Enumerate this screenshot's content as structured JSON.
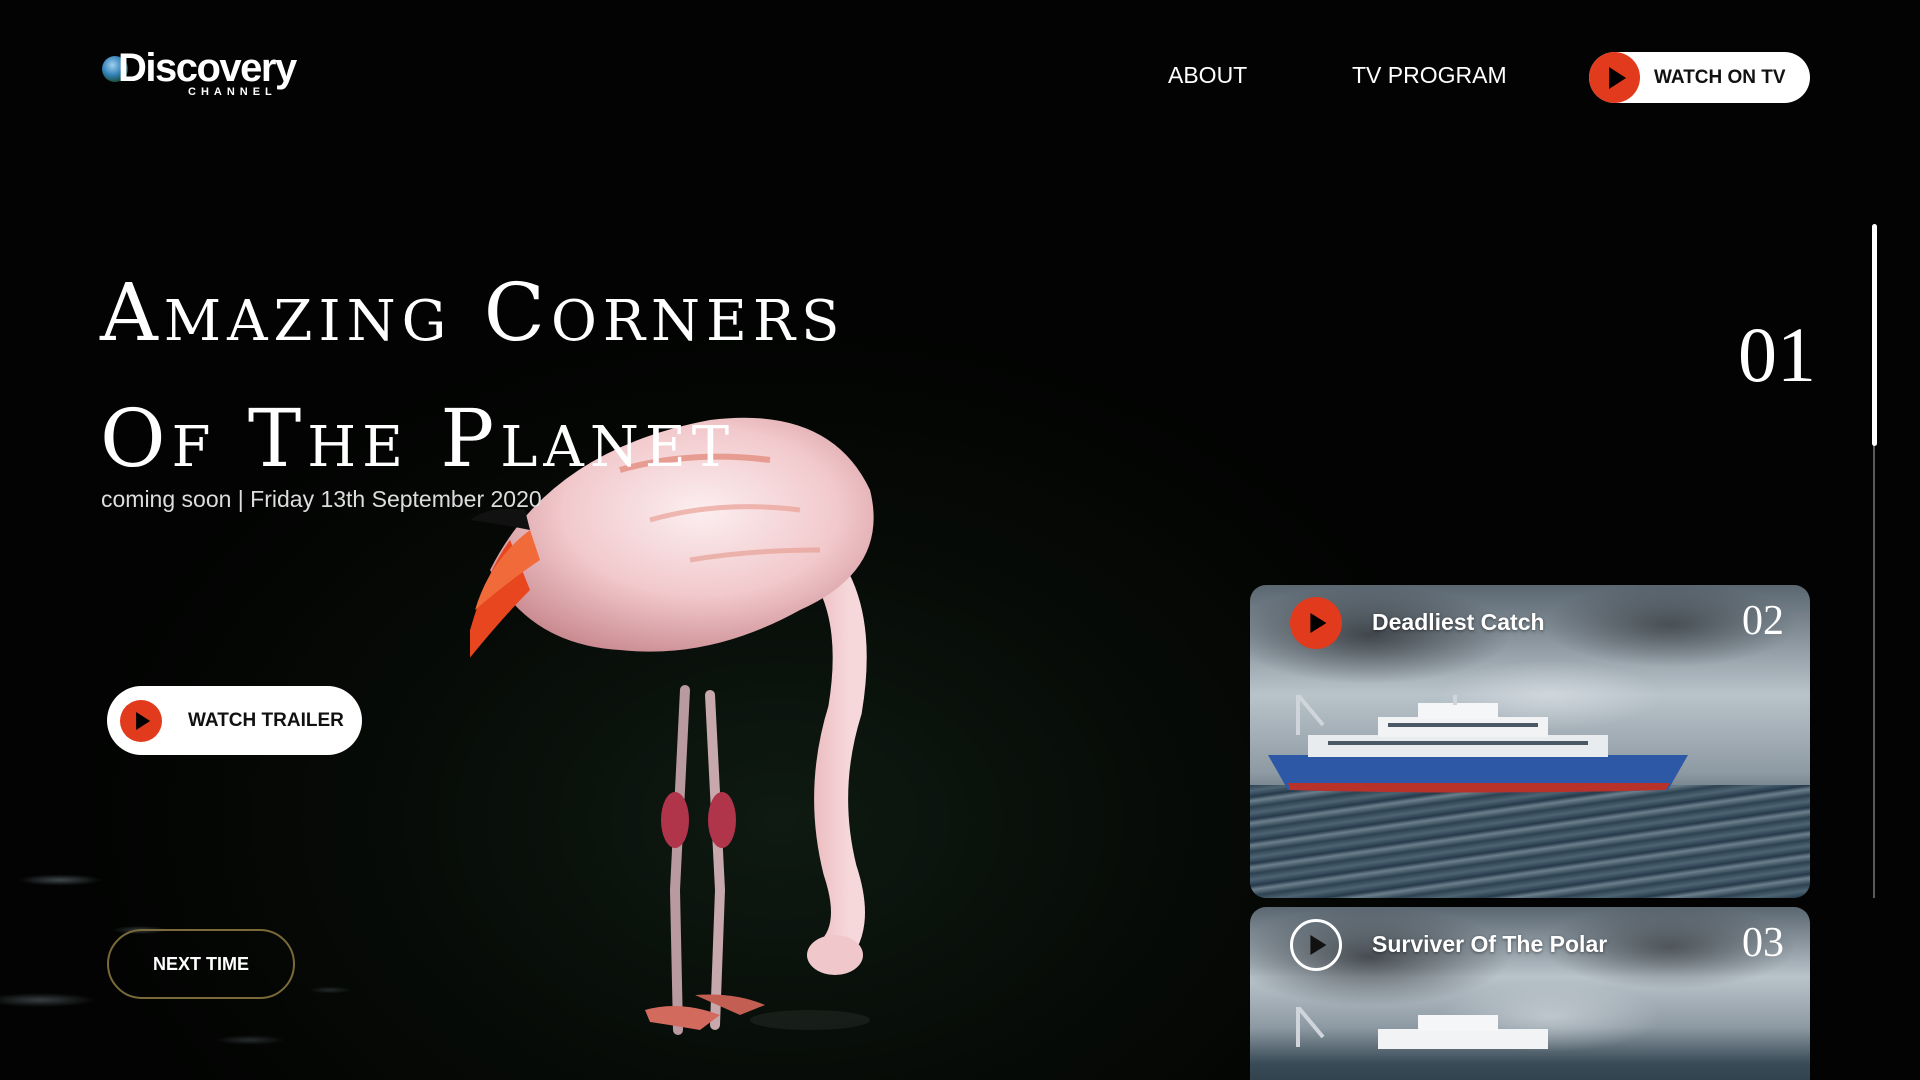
{
  "brand": {
    "name": "Discovery",
    "sub": "CHANNEL"
  },
  "nav": {
    "about": "ABOUT",
    "tv_program": "TV PROGRAM",
    "watch_on_tv": "WATCH ON TV"
  },
  "hero": {
    "title_line1": "Amazing Corners",
    "title_line2": "Of The Planet",
    "subtitle": "coming soon | Friday 13th September 2020",
    "watch_trailer": "WATCH TRAILER",
    "next_time": "NEXT TIME"
  },
  "slider": {
    "current": "01"
  },
  "cards": [
    {
      "title": "Deadliest Catch",
      "number": "02",
      "play_style": "filled"
    },
    {
      "title": "Surviver Of The Polar",
      "number": "03",
      "play_style": "outline"
    }
  ],
  "colors": {
    "accent": "#e23a1c",
    "background": "#030503",
    "outline_button": "#7a6a3a"
  },
  "icons": [
    "play-icon",
    "globe-icon"
  ]
}
